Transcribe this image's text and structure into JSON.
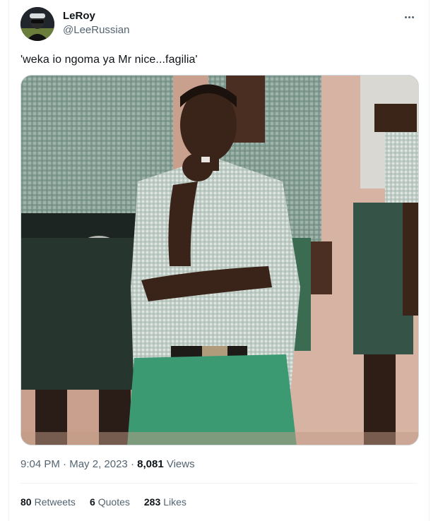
{
  "author": {
    "display_name": "LeRoy",
    "handle": "@LeeRussian"
  },
  "tweet": {
    "text": "'weka io ngoma ya Mr nice...fagilia'",
    "time": "9:04 PM",
    "separator": "·",
    "date": "May 2, 2023",
    "views_count": "8,081",
    "views_label": "Views"
  },
  "stats": {
    "retweets_count": "80",
    "retweets_label": "Retweets",
    "quotes_count": "6",
    "quotes_label": "Quotes",
    "likes_count": "283",
    "likes_label": "Likes"
  },
  "icons": {
    "more": "more-horizontal-icon"
  },
  "colors": {
    "text_primary": "#0f1419",
    "text_secondary": "#536471",
    "border": "#eff3f4"
  }
}
